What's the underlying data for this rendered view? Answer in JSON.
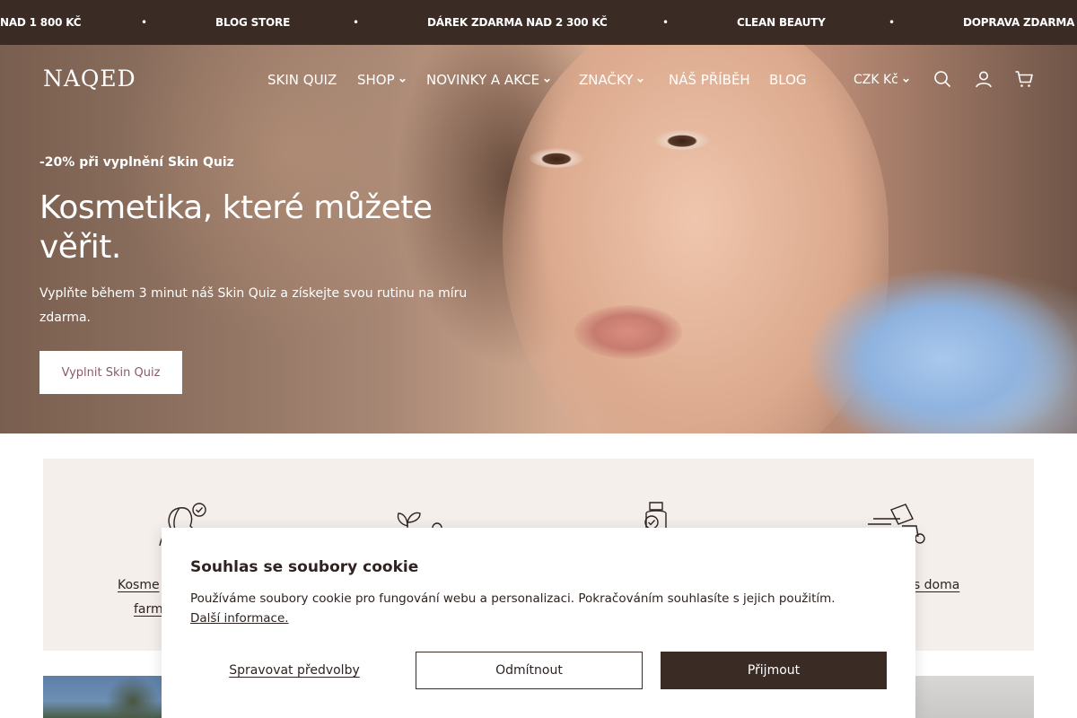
{
  "announcement": {
    "items": [
      "NAD 1 800 KČ",
      "BLOG STORE",
      "DÁREK ZDARMA NAD 2 300 KČ",
      "CLEAN BEAUTY",
      "DOPRAVA ZDARMA N"
    ],
    "separator": "•",
    "background": "#3a2b24"
  },
  "header": {
    "logo": "NAQED",
    "nav": [
      {
        "label": "SKIN QUIZ",
        "dropdown": false
      },
      {
        "label": "SHOP",
        "dropdown": true
      },
      {
        "label": "NOVINKY A AKCE",
        "dropdown": true
      },
      {
        "label": "ZNAČKY",
        "dropdown": true
      },
      {
        "label": "NÁŠ PŘÍBĚH",
        "dropdown": false
      },
      {
        "label": "BLOG",
        "dropdown": false
      }
    ],
    "currency": "CZK Kč",
    "icons": [
      "search-icon",
      "account-icon",
      "cart-icon"
    ]
  },
  "hero": {
    "promo": "-20% při vyplnění Skin Quiz",
    "title": "Kosmetika, které můžete věřit.",
    "subtitle": "Vyplňte během 3 minut náš Skin Quiz a získejte svou rutinu na míru zdarma.",
    "button": "Vyplnit Skin Quiz"
  },
  "features": {
    "items": [
      {
        "icon": "woman-check-icon",
        "label_line1": "Kosme",
        "label_line2": "farm"
      },
      {
        "icon": "plant-lab-icon"
      },
      {
        "icon": "bottle-check-icon"
      },
      {
        "icon": "delivery-icon",
        "label_line1": "us doma"
      }
    ],
    "background": "#f4efeb"
  },
  "cookie": {
    "title": "Souhlas se soubory cookie",
    "text": "Používáme soubory cookie pro fungování webu a personalizaci. Pokračováním souhlasíte s jejich použitím.",
    "link": "Další informace.",
    "manage": "Spravovat předvolby",
    "reject": "Odmítnout",
    "accept": "Přijmout",
    "accent": "#3a2b24"
  }
}
